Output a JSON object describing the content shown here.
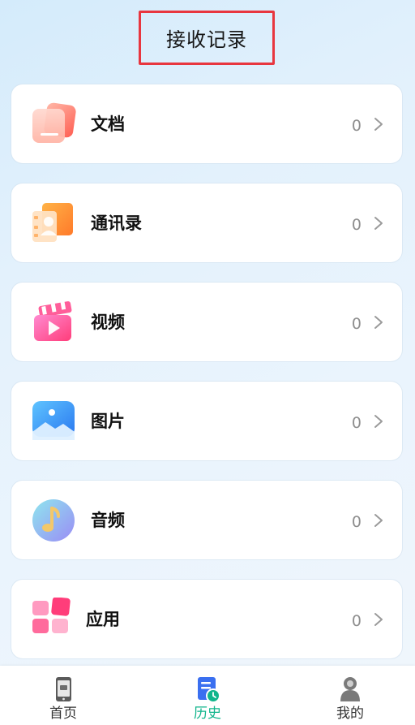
{
  "header": {
    "title": "接收记录"
  },
  "records": [
    {
      "label": "文档",
      "count": "0",
      "icon": "document-icon"
    },
    {
      "label": "通讯录",
      "count": "0",
      "icon": "contacts-icon"
    },
    {
      "label": "视频",
      "count": "0",
      "icon": "video-icon"
    },
    {
      "label": "图片",
      "count": "0",
      "icon": "image-icon"
    },
    {
      "label": "音频",
      "count": "0",
      "icon": "audio-icon"
    },
    {
      "label": "应用",
      "count": "0",
      "icon": "apps-icon"
    }
  ],
  "tabbar": {
    "tabs": [
      {
        "label": "首页",
        "icon": "phone-icon",
        "active": false
      },
      {
        "label": "历史",
        "icon": "history-icon",
        "active": true
      },
      {
        "label": "我的",
        "icon": "profile-icon",
        "active": false
      }
    ]
  },
  "colors": {
    "accent": "#11b58c",
    "highlight_border": "#e8363f"
  }
}
